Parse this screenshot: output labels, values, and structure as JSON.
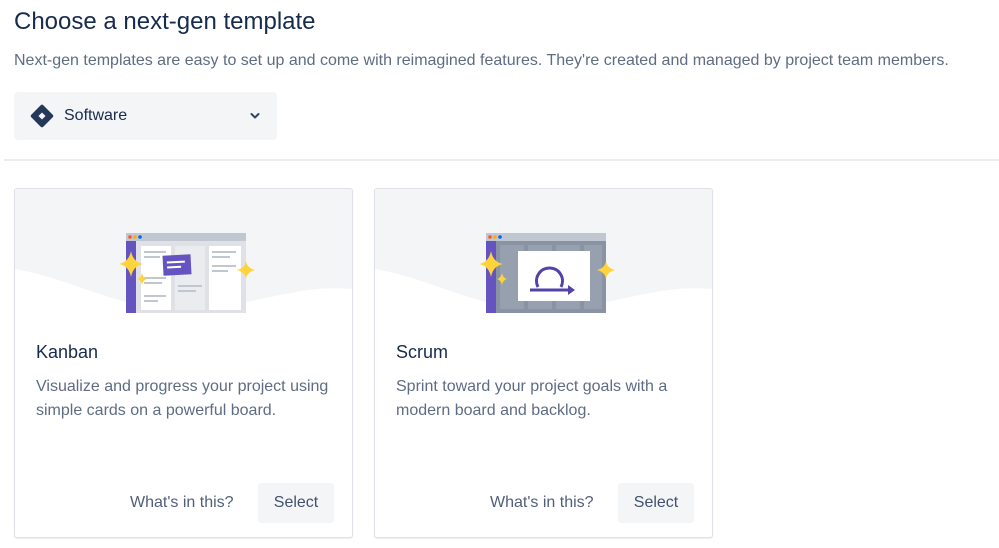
{
  "page": {
    "title": "Choose a next-gen template",
    "subtitle": "Next-gen templates are easy to set up and come with reimagined features. They're created and managed by project team members."
  },
  "category_select": {
    "value": "Software",
    "icon": "jira-software-diamond-icon"
  },
  "templates": [
    {
      "name": "Kanban",
      "description": "Visualize and progress your project using simple cards on a powerful board.",
      "info_link": "What's in this?",
      "select_label": "Select",
      "illustration": "kanban-board-illustration"
    },
    {
      "name": "Scrum",
      "description": "Sprint toward your project goals with a modern board and backlog.",
      "info_link": "What's in this?",
      "select_label": "Select",
      "illustration": "scrum-sprint-illustration"
    }
  ],
  "colors": {
    "heading": "#172b4d",
    "muted_text": "#5e6c84",
    "button_bg": "#f4f5f7",
    "accent_purple": "#6554c0",
    "sparkle_yellow": "#ffd43b"
  }
}
